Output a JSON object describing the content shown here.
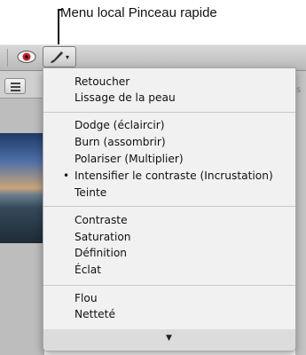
{
  "callout": {
    "text": "Menu local Pinceau rapide"
  },
  "toolbar": {
    "eye_icon": "eye-icon",
    "brush_icon": "brush-icon",
    "brush_caret": "▾",
    "list_icon": "list-icon",
    "right_edge_text": "s"
  },
  "menu": {
    "selected_bullet": "•",
    "groups": [
      {
        "items": [
          "Retoucher",
          "Lissage de la peau"
        ]
      },
      {
        "items": [
          "Dodge (éclaircir)",
          "Burn (assombrir)",
          "Polariser (Multiplier)",
          "Intensifier le contraste (Incrustation)",
          "Teinte"
        ]
      },
      {
        "items": [
          "Contraste",
          "Saturation",
          "Définition",
          "Éclat"
        ]
      },
      {
        "items": [
          "Flou",
          "Netteté"
        ]
      }
    ],
    "scroll_arrow": "▼"
  }
}
